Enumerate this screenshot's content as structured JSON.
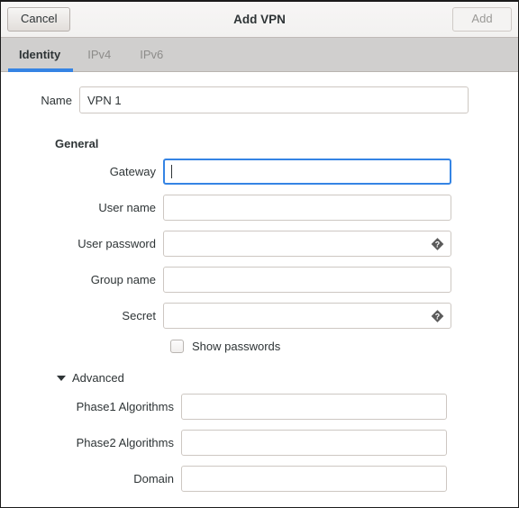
{
  "window": {
    "title": "Add VPN"
  },
  "header": {
    "cancel_label": "Cancel",
    "add_label": "Add"
  },
  "tabs": [
    {
      "label": "Identity",
      "active": true
    },
    {
      "label": "IPv4",
      "active": false
    },
    {
      "label": "IPv6",
      "active": false
    }
  ],
  "form": {
    "name": {
      "label": "Name",
      "value": "VPN 1",
      "placeholder": ""
    },
    "general": {
      "heading": "General",
      "fields": [
        {
          "label": "Gateway",
          "value": "",
          "placeholder": "",
          "focused": true,
          "icon": ""
        },
        {
          "label": "User name",
          "value": "",
          "placeholder": "",
          "focused": false,
          "icon": ""
        },
        {
          "label": "User password",
          "value": "",
          "placeholder": "",
          "focused": false,
          "icon": "question-diamond-icon"
        },
        {
          "label": "Group name",
          "value": "",
          "placeholder": "",
          "focused": false,
          "icon": ""
        },
        {
          "label": "Secret",
          "value": "",
          "placeholder": "",
          "focused": false,
          "icon": "question-diamond-icon"
        }
      ],
      "show_passwords": {
        "label": "Show passwords",
        "checked": false
      }
    },
    "advanced": {
      "heading": "Advanced",
      "expanded": true,
      "fields": [
        {
          "label": "Phase1 Algorithms",
          "value": "",
          "placeholder": ""
        },
        {
          "label": "Phase2 Algorithms",
          "value": "",
          "placeholder": ""
        },
        {
          "label": "Domain",
          "value": "",
          "placeholder": ""
        }
      ]
    }
  },
  "colors": {
    "accent": "#3584e4",
    "headerbar_bg": "#f2f1f0",
    "tabbar_bg": "#d0cfce",
    "text": "#2e3436",
    "muted_text": "#8d8c8a",
    "field_border": "#cdc7c2",
    "icon_fill": "#5a5a5a"
  }
}
